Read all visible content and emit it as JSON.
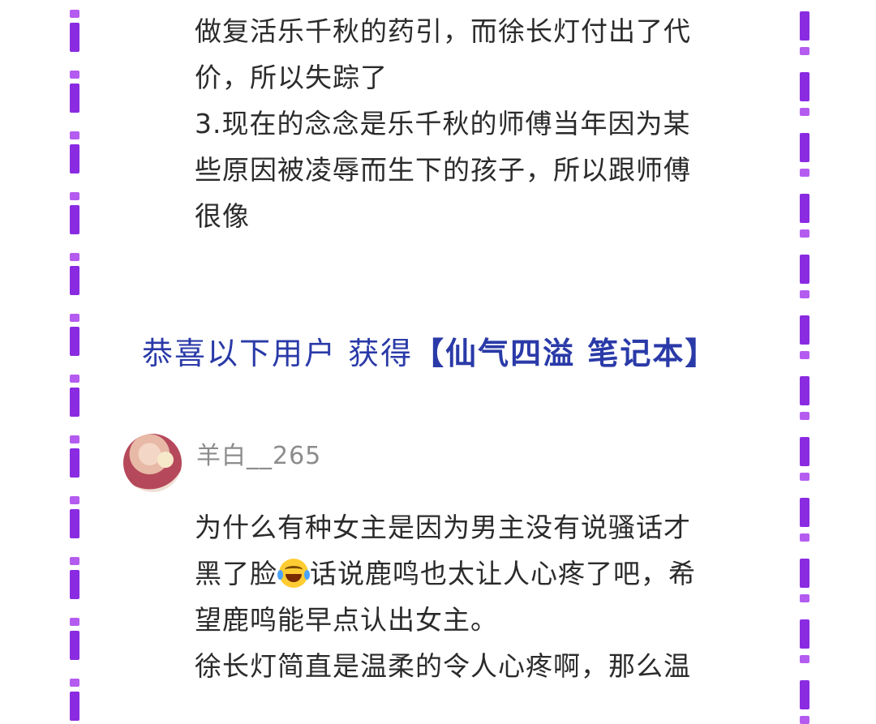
{
  "colors": {
    "rail_dot": "#b45cf0",
    "rail_bar": "#8a2be2",
    "banner_text": "#2a3aa8",
    "body_text": "#2b2b2b",
    "username": "#8c8c8c"
  },
  "top_text": {
    "lines": [
      "做复活乐千秋的药引，而徐长灯付出了代",
      "价，所以失踪了",
      "3.现在的念念是乐千秋的师傅当年因为某",
      "些原因被凌辱而生下的孩子，所以跟师傅",
      "很像"
    ]
  },
  "banner": {
    "prefix": "恭喜以下用户 获得",
    "highlight": "【仙气四溢 笔记本】"
  },
  "comment": {
    "username": "羊白__265",
    "line1": "为什么有种女主是因为男主没有说骚话才",
    "line2_before": "黑了脸",
    "emoji_name": "face-with-tears-of-joy-icon",
    "line2_after": "话说鹿鸣也太让人心疼了吧，希",
    "line3": "望鹿鸣能早点认出女主。",
    "line4": "徐长灯简直是温柔的令人心疼啊，那么温"
  }
}
